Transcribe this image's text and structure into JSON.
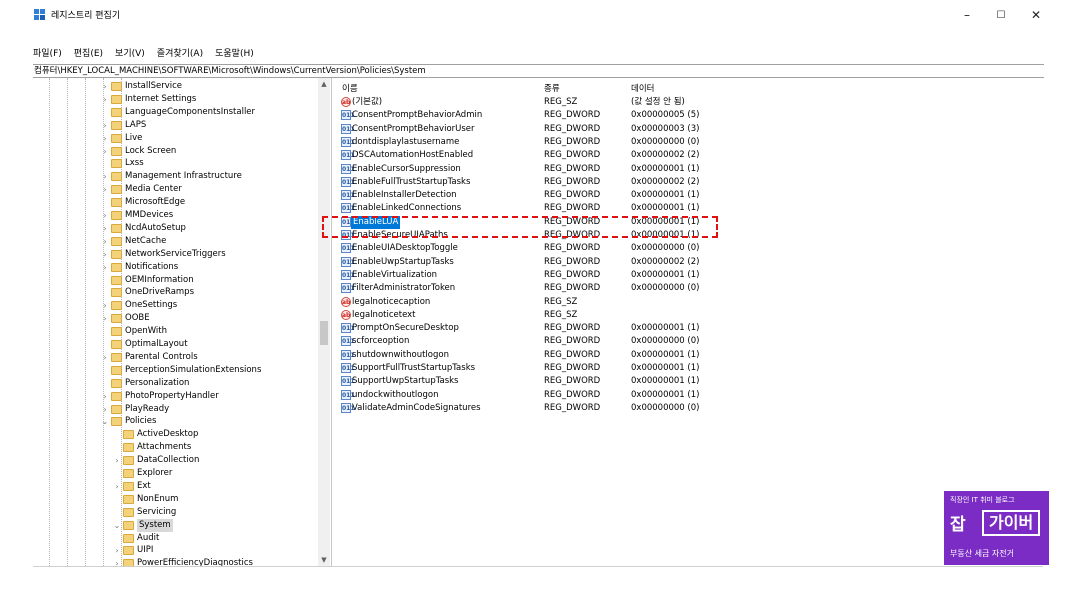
{
  "window": {
    "title": "레지스트리 편집기",
    "controls": {
      "minimize": "–",
      "maximize": "☐",
      "close": "✕"
    }
  },
  "menu": [
    "파일(F)",
    "편집(E)",
    "보기(V)",
    "즐겨찾기(A)",
    "도움말(H)"
  ],
  "address": "컴퓨터\\HKEY_LOCAL_MACHINE\\SOFTWARE\\Microsoft\\Windows\\CurrentVersion\\Policies\\System",
  "tree": [
    {
      "label": "InstallService",
      "expander": "›"
    },
    {
      "label": "Internet Settings",
      "expander": "›"
    },
    {
      "label": "LanguageComponentsInstaller",
      "expander": ""
    },
    {
      "label": "LAPS",
      "expander": "›"
    },
    {
      "label": "Live",
      "expander": "›"
    },
    {
      "label": "Lock Screen",
      "expander": "›"
    },
    {
      "label": "Lxss",
      "expander": ""
    },
    {
      "label": "Management Infrastructure",
      "expander": "›"
    },
    {
      "label": "Media Center",
      "expander": "›"
    },
    {
      "label": "MicrosoftEdge",
      "expander": ""
    },
    {
      "label": "MMDevices",
      "expander": "›"
    },
    {
      "label": "NcdAutoSetup",
      "expander": "›"
    },
    {
      "label": "NetCache",
      "expander": "›"
    },
    {
      "label": "NetworkServiceTriggers",
      "expander": "›"
    },
    {
      "label": "Notifications",
      "expander": "›"
    },
    {
      "label": "OEMInformation",
      "expander": ""
    },
    {
      "label": "OneDriveRamps",
      "expander": ""
    },
    {
      "label": "OneSettings",
      "expander": "›"
    },
    {
      "label": "OOBE",
      "expander": "›"
    },
    {
      "label": "OpenWith",
      "expander": ""
    },
    {
      "label": "OptimalLayout",
      "expander": ""
    },
    {
      "label": "Parental Controls",
      "expander": "›"
    },
    {
      "label": "PerceptionSimulationExtensions",
      "expander": ""
    },
    {
      "label": "Personalization",
      "expander": ""
    },
    {
      "label": "PhotoPropertyHandler",
      "expander": "›"
    },
    {
      "label": "PlayReady",
      "expander": "›"
    },
    {
      "label": "Policies",
      "expander": "⌄"
    },
    {
      "label": "ActiveDesktop",
      "expander": ""
    },
    {
      "label": "Attachments",
      "expander": ""
    },
    {
      "label": "DataCollection",
      "expander": "›"
    },
    {
      "label": "Explorer",
      "expander": ""
    },
    {
      "label": "Ext",
      "expander": "›"
    },
    {
      "label": "NonEnum",
      "expander": ""
    },
    {
      "label": "Servicing",
      "expander": ""
    },
    {
      "label": "System",
      "expander": "⌄",
      "selected": true
    },
    {
      "label": "Audit",
      "expander": ""
    },
    {
      "label": "UIPI",
      "expander": "›"
    },
    {
      "label": "PowerEfficiencyDiagnostics",
      "expander": "›"
    }
  ],
  "columns": {
    "name": "이름",
    "type": "종류",
    "data": "데이터"
  },
  "values": [
    {
      "name": "(기본값)",
      "type": "REG_SZ",
      "data": "(값 설정 안 됨)",
      "icon": "ab"
    },
    {
      "name": "ConsentPromptBehaviorAdmin",
      "type": "REG_DWORD",
      "data": "0x00000005 (5)",
      "icon": "bin"
    },
    {
      "name": "ConsentPromptBehaviorUser",
      "type": "REG_DWORD",
      "data": "0x00000003 (3)",
      "icon": "bin"
    },
    {
      "name": "dontdisplaylastusername",
      "type": "REG_DWORD",
      "data": "0x00000000 (0)",
      "icon": "bin"
    },
    {
      "name": "DSCAutomationHostEnabled",
      "type": "REG_DWORD",
      "data": "0x00000002 (2)",
      "icon": "bin"
    },
    {
      "name": "EnableCursorSuppression",
      "type": "REG_DWORD",
      "data": "0x00000001 (1)",
      "icon": "bin"
    },
    {
      "name": "EnableFullTrustStartupTasks",
      "type": "REG_DWORD",
      "data": "0x00000002 (2)",
      "icon": "bin"
    },
    {
      "name": "EnableInstallerDetection",
      "type": "REG_DWORD",
      "data": "0x00000001 (1)",
      "icon": "bin"
    },
    {
      "name": "EnableLinkedConnections",
      "type": "REG_DWORD",
      "data": "0x00000001 (1)",
      "icon": "bin"
    },
    {
      "name": "EnableLUA",
      "type": "REG_DWORD",
      "data": "0x00000001 (1)",
      "icon": "bin",
      "selected": true
    },
    {
      "name": "EnableSecureUIAPaths",
      "type": "REG_DWORD",
      "data": "0x00000001 (1)",
      "icon": "bin"
    },
    {
      "name": "EnableUIADesktopToggle",
      "type": "REG_DWORD",
      "data": "0x00000000 (0)",
      "icon": "bin"
    },
    {
      "name": "EnableUwpStartupTasks",
      "type": "REG_DWORD",
      "data": "0x00000002 (2)",
      "icon": "bin"
    },
    {
      "name": "EnableVirtualization",
      "type": "REG_DWORD",
      "data": "0x00000001 (1)",
      "icon": "bin"
    },
    {
      "name": "FilterAdministratorToken",
      "type": "REG_DWORD",
      "data": "0x00000000 (0)",
      "icon": "bin"
    },
    {
      "name": "legalnoticecaption",
      "type": "REG_SZ",
      "data": "",
      "icon": "ab"
    },
    {
      "name": "legalnoticetext",
      "type": "REG_SZ",
      "data": "",
      "icon": "ab"
    },
    {
      "name": "PromptOnSecureDesktop",
      "type": "REG_DWORD",
      "data": "0x00000001 (1)",
      "icon": "bin"
    },
    {
      "name": "scforceoption",
      "type": "REG_DWORD",
      "data": "0x00000000 (0)",
      "icon": "bin"
    },
    {
      "name": "shutdownwithoutlogon",
      "type": "REG_DWORD",
      "data": "0x00000001 (1)",
      "icon": "bin"
    },
    {
      "name": "SupportFullTrustStartupTasks",
      "type": "REG_DWORD",
      "data": "0x00000001 (1)",
      "icon": "bin"
    },
    {
      "name": "SupportUwpStartupTasks",
      "type": "REG_DWORD",
      "data": "0x00000001 (1)",
      "icon": "bin"
    },
    {
      "name": "undockwithoutlogon",
      "type": "REG_DWORD",
      "data": "0x00000001 (1)",
      "icon": "bin"
    },
    {
      "name": "ValidateAdminCodeSignatures",
      "type": "REG_DWORD",
      "data": "0x00000000 (0)",
      "icon": "bin"
    }
  ],
  "icons": {
    "string_value": "ab",
    "binary_value": "011"
  },
  "watermark": {
    "top": "직장인 IT 취미 블로그",
    "big": "잡",
    "badge": "가이버",
    "bottom": "부동산 세금 자전거"
  },
  "colors": {
    "selection": "#0078d7",
    "highlight_box": "#e01010",
    "watermark_bg": "#7a2cc4"
  }
}
